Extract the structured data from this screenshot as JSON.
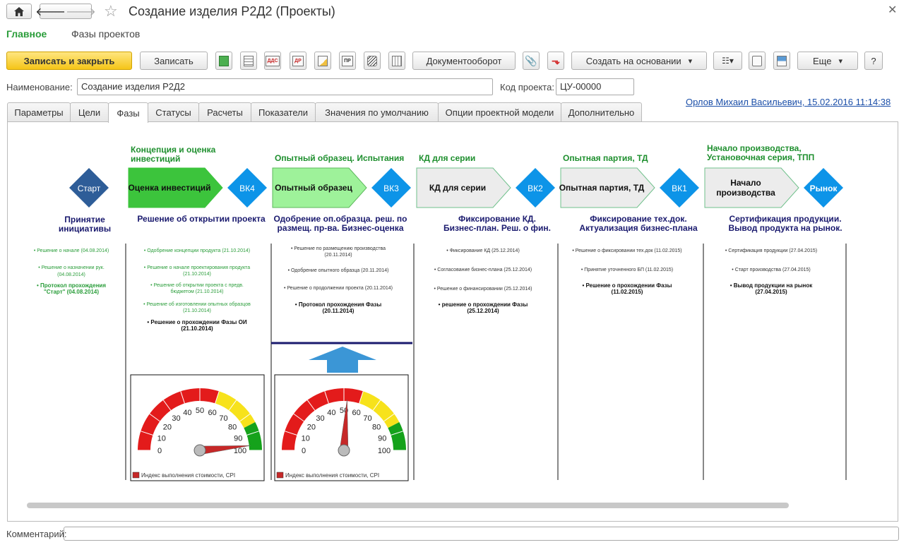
{
  "window": {
    "title": "Создание изделия Р2Д2 (Проекты)"
  },
  "sections": {
    "main": "Главное",
    "phases": "Фазы проектов"
  },
  "toolbar": {
    "save_close": "Записать и закрыть",
    "save": "Записать",
    "docflow": "Документооборот",
    "create_based": "Создать на основании",
    "more": "Еще",
    "help": "?",
    "icon_labels": [
      "ДДС",
      "ДР",
      "ПР"
    ]
  },
  "fields": {
    "name_label": "Наименование:",
    "name_value": "Создание изделия Р2Д2",
    "code_label": "Код проекта:",
    "code_value": "ЦУ-00000"
  },
  "author_link": "Орлов Михаил Васильевич, 15.02.2016 11:14:38",
  "tabs": [
    "Параметры",
    "Цели",
    "Фазы",
    "Статусы",
    "Расчеты",
    "Показатели",
    "Значения  по умолчанию",
    "Опции проектной модели",
    "Дополнительно"
  ],
  "active_tab": "Фазы",
  "diagram": {
    "start": "Старт",
    "market": "Рынок",
    "start_caption": [
      "Принятие",
      "инициативы"
    ],
    "start_items": [
      {
        "text": "• Решение о начале (04.08.2014)",
        "bold": false
      },
      {
        "text": "• Решение о назначении рук.",
        "bold": false
      },
      {
        "text": "(04.08.2014)",
        "bold": false
      },
      {
        "text": "• Протокол прохождения",
        "bold": true
      },
      {
        "text": "\"Старт\" (04.08.2014)",
        "bold": true
      }
    ],
    "phases": [
      {
        "header": [
          "Концепция и оценка",
          "инвестиций"
        ],
        "box": [
          "Оценка инвестиций"
        ],
        "gate": "ВК4",
        "caption": [
          "Решение об открытии проекта"
        ],
        "items": [
          {
            "text": "• Одобрение концепции продукта (21.10.2014)",
            "bold": false
          },
          {
            "text": "• Решение о начале проектирования продукта",
            "bold": false
          },
          {
            "text": "(21.10.2014)",
            "bold": false
          },
          {
            "text": "• Решение об открытии проекта с предв.",
            "bold": false
          },
          {
            "text": "бюджетом (21.10.2014)",
            "bold": false
          },
          {
            "text": "• Решение об изготовлении опытных образцов",
            "bold": false
          },
          {
            "text": "(21.10.2014)",
            "bold": false
          },
          {
            "text": "• Решение о прохождении Фазы ОИ",
            "bold": true
          },
          {
            "text": "(21.10.2014)",
            "bold": true
          }
        ]
      },
      {
        "header": [
          "Опытный образец. Испытания"
        ],
        "box": [
          "Опытный образец"
        ],
        "gate": "ВК3",
        "caption": [
          "Одобрение оп.образца. реш. по",
          "размещ. пр-ва. Бизнес-оценка"
        ],
        "items": [
          {
            "text": "• Решение по размещению производства",
            "bold": false
          },
          {
            "text": "(20.11.2014)",
            "bold": false
          },
          {
            "text": "• Одобрение опытного образца (20.11.2014)",
            "bold": false
          },
          {
            "text": "• Решение о продолжении проекта (20.11.2014)",
            "bold": false
          },
          {
            "text": "• Протокол прохождения Фазы",
            "bold": true
          },
          {
            "text": "(20.11.2014)",
            "bold": true
          }
        ]
      },
      {
        "header": [
          "КД для серии"
        ],
        "box": [
          "КД для серии"
        ],
        "gate": "ВК2",
        "caption": [
          "Фиксирование КД.",
          "Бизнес-план. Реш. о фин."
        ],
        "items": [
          {
            "text": "• Фиксирование КД (25.12.2014)",
            "bold": false
          },
          {
            "text": "• Согласование бизнес-плана (25.12.2014)",
            "bold": false
          },
          {
            "text": "• Решение о финансировании (25.12.2014)",
            "bold": false
          },
          {
            "text": "• решение о прохождении Фазы",
            "bold": true
          },
          {
            "text": "(25.12.2014)",
            "bold": true
          }
        ]
      },
      {
        "header": [
          "Опытная партия, ТД"
        ],
        "box": [
          "Опытная партия, ТД"
        ],
        "gate": "ВК1",
        "caption": [
          "Фиксирование тех.док.",
          "Актуализация бизнес-плана"
        ],
        "items": [
          {
            "text": "• Решение о фиксировании тех.док (11.02.2015)",
            "bold": false
          },
          {
            "text": "• Принятие уточненного БП (11.02.2015)",
            "bold": false
          },
          {
            "text": "• Решение о прохождении Фазы",
            "bold": true
          },
          {
            "text": "(11.02.2015)",
            "bold": true
          }
        ]
      },
      {
        "header": [
          "Начало производства,",
          "Установочная серия, ТПП"
        ],
        "box": [
          "Начало",
          "производства"
        ],
        "gate": "Рынок",
        "caption": [
          "Сертификация продукции.",
          "Вывод продукта на рынок."
        ],
        "items": [
          {
            "text": "• Сертификация продукции (27.04.2015)",
            "bold": false
          },
          {
            "text": "• Старт производства (27.04.2015)",
            "bold": false
          },
          {
            "text": "• Вывод продукции на рынок",
            "bold": true
          },
          {
            "text": "(27.04.2015)",
            "bold": true
          }
        ]
      }
    ],
    "gauges": [
      {
        "value": 97,
        "legend": "Индекс выполнения стоимости, CPI",
        "ticks": [
          "0",
          "10",
          "20",
          "30",
          "40",
          "50",
          "60",
          "70",
          "80",
          "90",
          "100"
        ]
      },
      {
        "value": 52,
        "legend": "Индекс выполнения стоимости, CPI",
        "ticks": [
          "0",
          "10",
          "20",
          "30",
          "40",
          "50",
          "60",
          "70",
          "80",
          "90",
          "100"
        ]
      }
    ],
    "colors": {
      "diamond_start": "#2e5d98",
      "diamond_gate": "#0d94e8",
      "phase_done": "#3cc43c",
      "phase_current": "#9ef29a",
      "phase_future": "#ececec",
      "header_text": "#1e8f2e",
      "caption_text": "#1a1a6e",
      "arrow": "#3b96d6"
    }
  },
  "comment_label": "Комментарий:"
}
